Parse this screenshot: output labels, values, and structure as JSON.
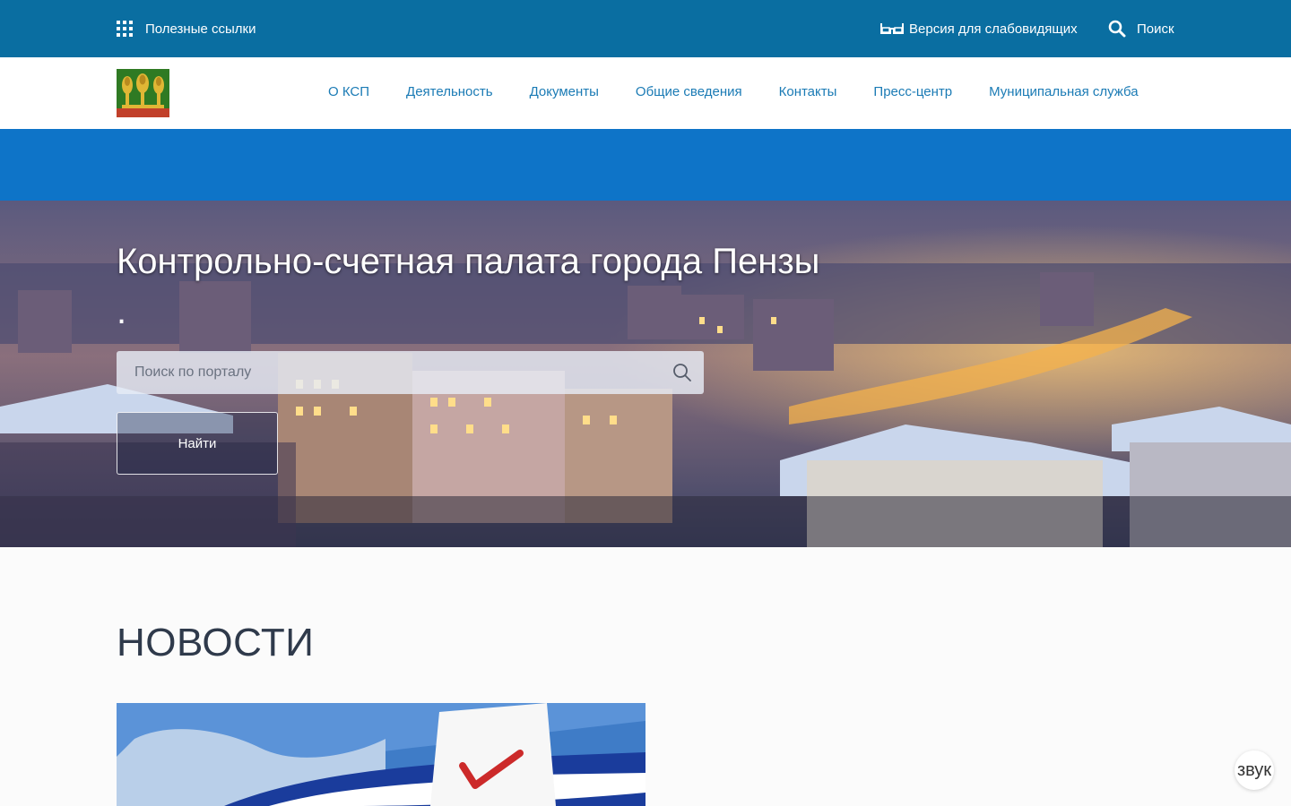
{
  "topbar": {
    "useful_links": "Полезные ссылки",
    "vision_version": "Версия для слабовидящих",
    "search": "Поиск",
    "bg_color": "#0a6ea1"
  },
  "nav": {
    "items": [
      "О КСП",
      "Деятельность",
      "Документы",
      "Общие сведения",
      "Контакты",
      "Пресс-центр",
      "Муниципальная служба"
    ],
    "link_color": "#1b7bb5"
  },
  "band": {
    "color": "#0e74c8"
  },
  "hero": {
    "title": "Контрольно-счетная палата города Пензы",
    "subtitle": ".",
    "search_placeholder": "Поиск по порталу",
    "find_button": "Найти"
  },
  "news": {
    "heading": "НОВОСТИ"
  },
  "sound_button": "звук",
  "icons": {
    "links": "grid-icon",
    "vision": "glasses-icon",
    "search": "search-icon",
    "hero_search": "magnifier-icon"
  }
}
